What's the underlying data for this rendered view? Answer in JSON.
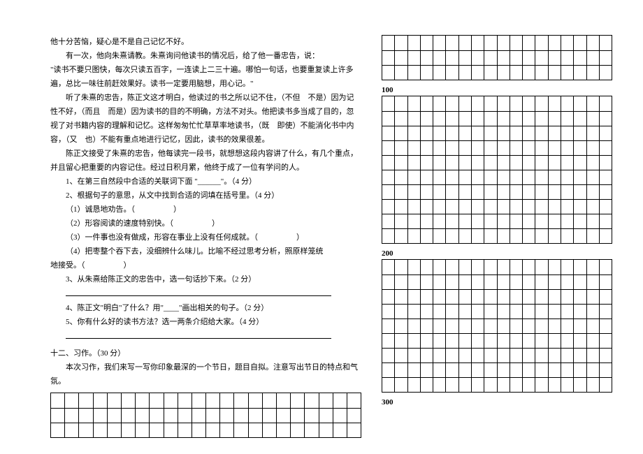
{
  "passage": {
    "l1": "他十分苦恼，疑心是不是自己记忆不好。",
    "l2": "有一次，他向朱熹请教。朱熹询问他读书的情况后，给了他一番忠告，说：",
    "l3": "\"读书不要只图快，每次只读五百字，一连读上二三十遍。哪怕一句话，也要重复读上许多遍，总比一味往前赶效果好。读书一定要用脑想，用心记。\"",
    "l4": "听了朱熹的忠告，陈正文这才明白，他读过的书之所以记不住，（不但　不是）因为记性不好，（而且　而是）因为读书的目的不明确，方法不对头。他把读书多当成了目的，忽视了对书籍内容的理解和记忆。这样匆匆忙忙草草率地读书，（既　即使）不能消化书中内容，（又　也）不能有重点地进行记忆，因此，读书的效果很差。",
    "l5": "陈正文接受了朱熹的忠告，他每读完一段书，就想想这段内容讲了什么，有几个重点，并且留心把重要的内容记住。经过日积月累，他终于成了一位有学问的人。"
  },
  "questions": {
    "q1": "1、在第三自然段中合适的关联词下面 \"______\"。（4 分）",
    "q2": "2、根据句子的意思，从文中找到合适的词填在括号里。（4 分）",
    "q2a": "（1）诚恳地劝告。（　　　　　）",
    "q2b": "（2）形容阅读的速度特别快。（　　　　　）",
    "q2c": "（3）一件事也没有做成，形容在事业上没有任何成就。（　　　　　）",
    "q2d": "（4）把枣整个吞下去，没细辨什么味儿。比喻不经过思考分析，照原样笼统",
    "q2d2": "地接受。（　　　　　）",
    "q3": "3、从朱熹给陈正文的忠告中，选一句话抄下来。（2 分）",
    "q4": "4、陈正文\"明白\"了什么？用\"____\"画出相关的句子。（2 分）",
    "q5": "5、你有什么好的读书方法？选一两条介绍给大家。（4 分）"
  },
  "section12": {
    "head": "十二、习作。（30 分）",
    "body": "本次习作，我们来写一写你印象最深的一个节日，题目自拟。注意写出节日的特点和气氛。"
  },
  "gridLabels": {
    "m100": "100",
    "m200": "200",
    "m300": "300"
  },
  "gridCols": 18
}
